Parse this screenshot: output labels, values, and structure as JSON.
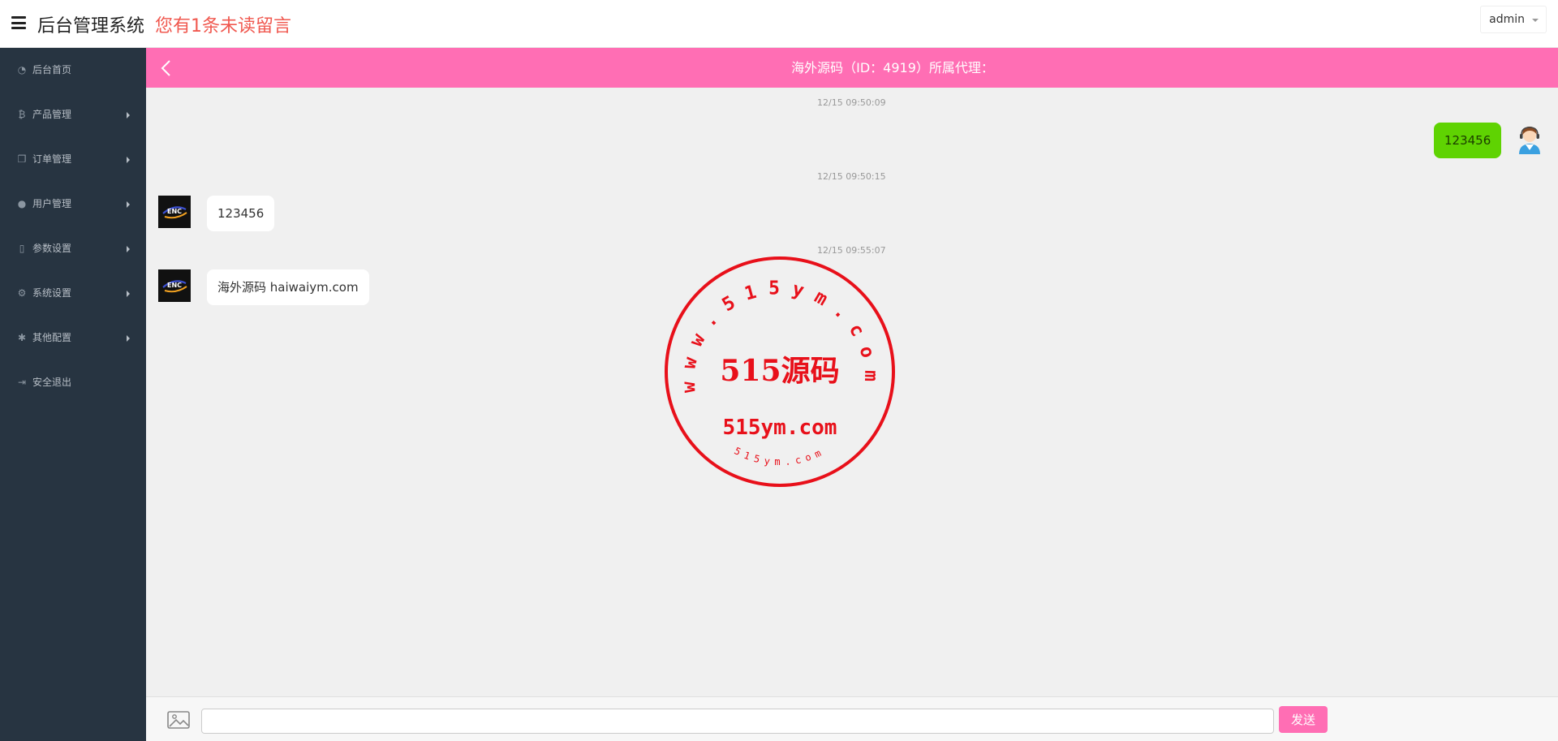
{
  "header": {
    "app_title": "后台管理系统",
    "notice": "您有1条未读留言",
    "user": "admin"
  },
  "sidebar": {
    "items": [
      {
        "label": "后台首页",
        "icon": "dashboard-icon",
        "has_submenu": false
      },
      {
        "label": "产品管理",
        "icon": "bitcoin-icon",
        "has_submenu": true
      },
      {
        "label": "订单管理",
        "icon": "copy-icon",
        "has_submenu": true
      },
      {
        "label": "用户管理",
        "icon": "user-icon",
        "has_submenu": true
      },
      {
        "label": "参数设置",
        "icon": "file-icon",
        "has_submenu": true
      },
      {
        "label": "系统设置",
        "icon": "cogs-icon",
        "has_submenu": true
      },
      {
        "label": "其他配置",
        "icon": "gear-icon",
        "has_submenu": true
      },
      {
        "label": "安全退出",
        "icon": "sign-out-icon",
        "has_submenu": false
      }
    ]
  },
  "chat": {
    "title": "海外源码（ID：4919）所属代理：",
    "messages": [
      {
        "time": "12/15 09:50:09",
        "side": "right",
        "text": "123456"
      },
      {
        "time": "12/15 09:50:15",
        "side": "left",
        "text": "123456"
      },
      {
        "time": "12/15 09:55:07",
        "side": "left",
        "text": "海外源码 haiwaiym.com"
      }
    ]
  },
  "avatar_text": "ENC",
  "watermark": {
    "arc_text": "www.515ym.com",
    "center_text": "515源码",
    "domain_text": "515ym.com",
    "small_text": "515ym.com",
    "color": "#e8101a"
  },
  "input": {
    "placeholder": "",
    "send_label": "发送"
  },
  "colors": {
    "accent": "#ff6eb4",
    "sidebar_bg": "#273441",
    "notice": "#f0584f",
    "bubble_self": "#5fd302"
  }
}
